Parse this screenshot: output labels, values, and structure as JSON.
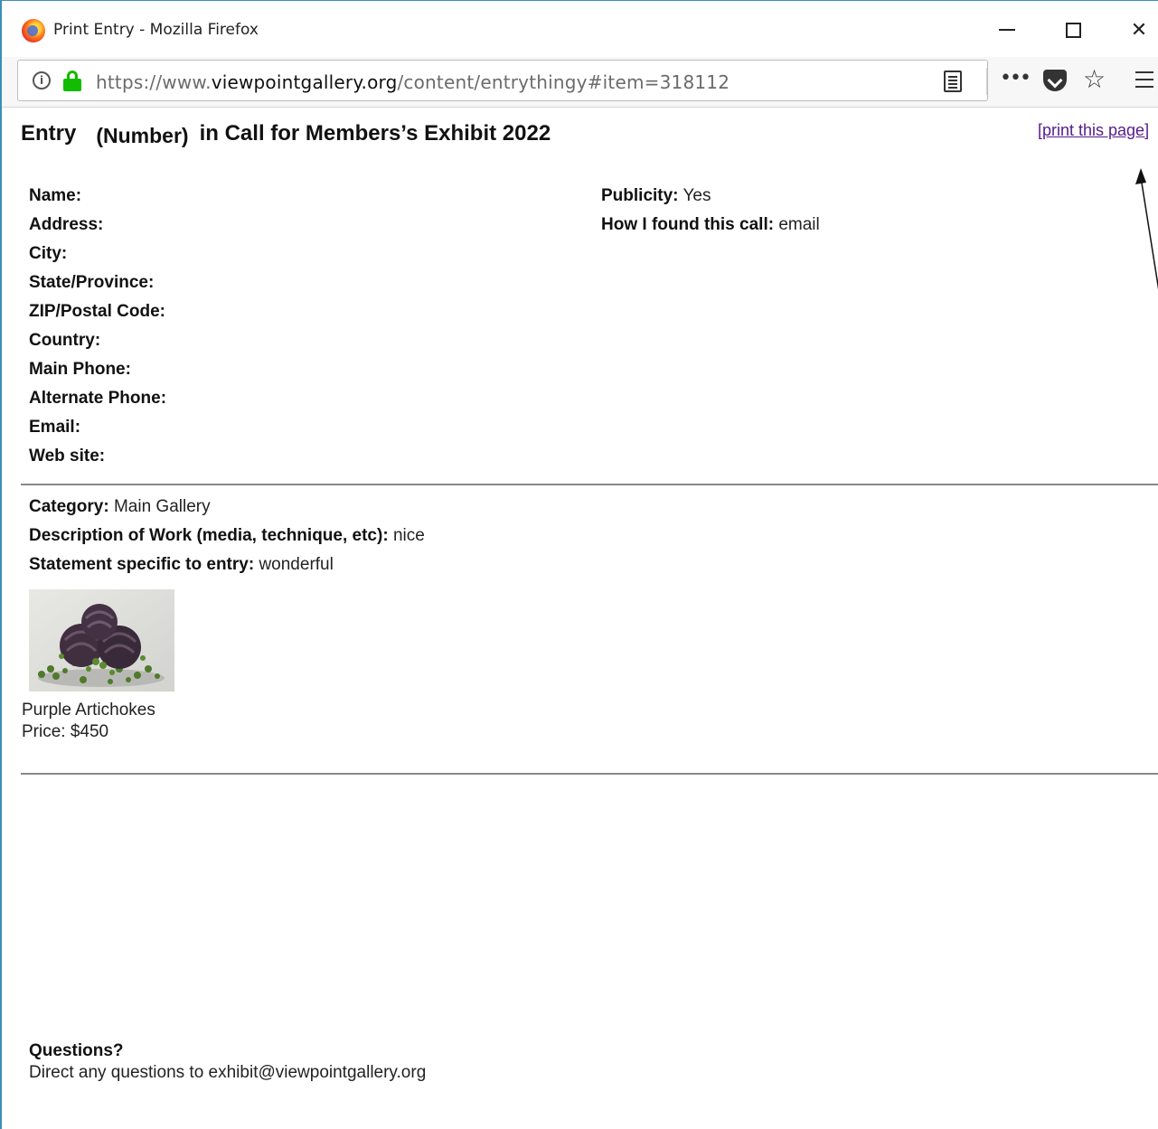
{
  "window": {
    "title": "Print Entry - Mozilla Firefox",
    "url_prefix": "https://www.",
    "url_host": "viewpointgallery.org",
    "url_path": "/content/entrythingy#item=318112",
    "more_glyph": "•••",
    "star_glyph": "☆",
    "info_glyph": "i",
    "close_glyph": "✕"
  },
  "page": {
    "heading_entry": "Entry",
    "heading_number": "(Number)",
    "heading_rest": "in Call for Members’s Exhibit 2022",
    "print_link": "[print this page]"
  },
  "contact": [
    {
      "label": "Name:",
      "value": ""
    },
    {
      "label": "Address:",
      "value": ""
    },
    {
      "label": "City:",
      "value": ""
    },
    {
      "label": "State/Province:",
      "value": ""
    },
    {
      "label": "ZIP/Postal Code:",
      "value": ""
    },
    {
      "label": "Country:",
      "value": ""
    },
    {
      "label": "Main Phone:",
      "value": ""
    },
    {
      "label": "Alternate Phone:",
      "value": ""
    },
    {
      "label": "Email:",
      "value": ""
    },
    {
      "label": "Web site:",
      "value": ""
    }
  ],
  "extra": [
    {
      "label": "Publicity:",
      "value": "Yes"
    },
    {
      "label": "How I found this call:",
      "value": "email"
    }
  ],
  "entry": [
    {
      "label": "Category:",
      "value": "Main Gallery"
    },
    {
      "label": "Description of Work (media, technique, etc):",
      "value": "nice"
    },
    {
      "label": "Statement specific to entry:",
      "value": "wonderful"
    }
  ],
  "artwork": {
    "title": "Purple Artichokes",
    "price": "Price: $450"
  },
  "footer": {
    "questions_title": "Questions?",
    "questions_text": "Direct any questions to exhibit@viewpointgallery.org"
  }
}
